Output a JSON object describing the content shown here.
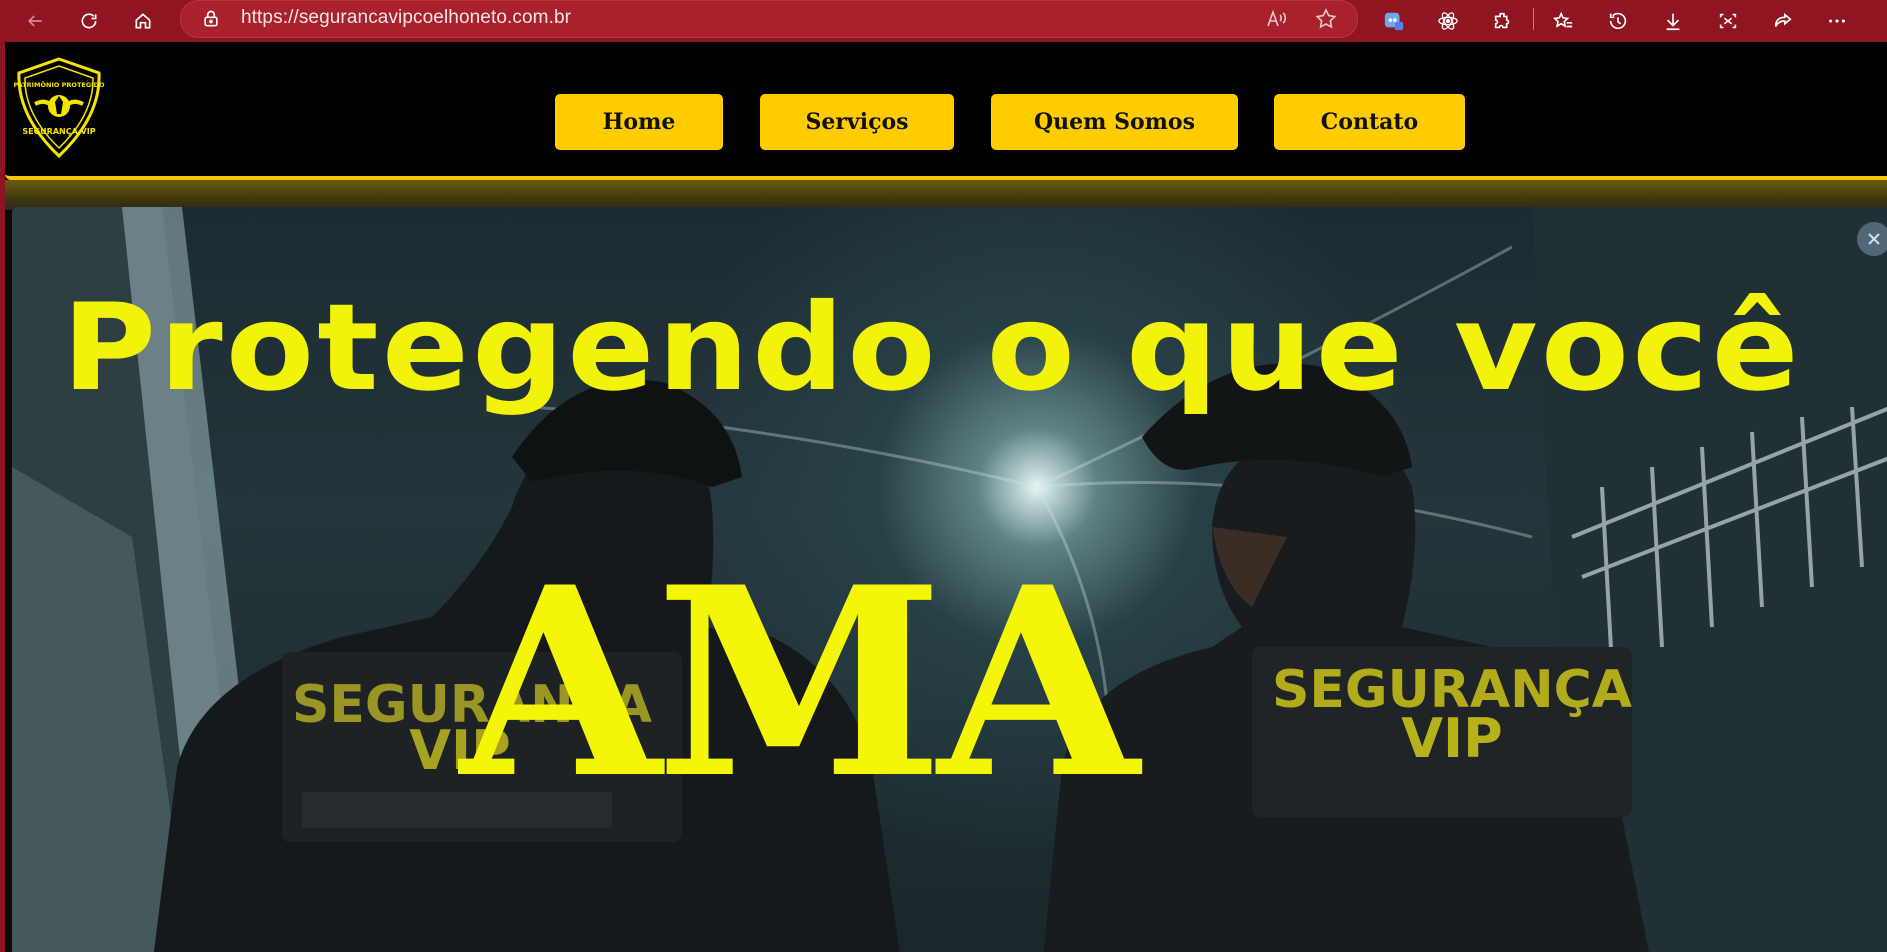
{
  "browser": {
    "url": "https://segurancavipcoelhoneto.com.br",
    "icons": [
      "back-icon",
      "refresh-icon",
      "home-icon",
      "lock-icon",
      "read-aloud-icon",
      "favorite-star-icon",
      "copilot-icon",
      "react-devtools-icon",
      "extensions-icon",
      "favorites-icon",
      "history-icon",
      "download-icon",
      "screenshot-icon",
      "share-icon",
      "more-icon"
    ]
  },
  "site": {
    "logo": {
      "top_text": "PATRIMÔNIO PROTEGIDO",
      "bottom_text": "SEGURANÇA VIP"
    },
    "nav": {
      "home": "Home",
      "services": "Serviços",
      "about": "Quem Somos",
      "contact": "Contato"
    },
    "hero": {
      "headline": "Protegendo o que você",
      "highlight": "AMA",
      "patch_left_line1": "SEGURANÇA",
      "patch_left_line2": "VIP",
      "patch_right_line1": "SEGURANÇA",
      "patch_right_line2": "VIP"
    }
  },
  "colors": {
    "accent": "#ffcc00",
    "headline": "#f2f20a",
    "chrome": "#8f1521"
  }
}
